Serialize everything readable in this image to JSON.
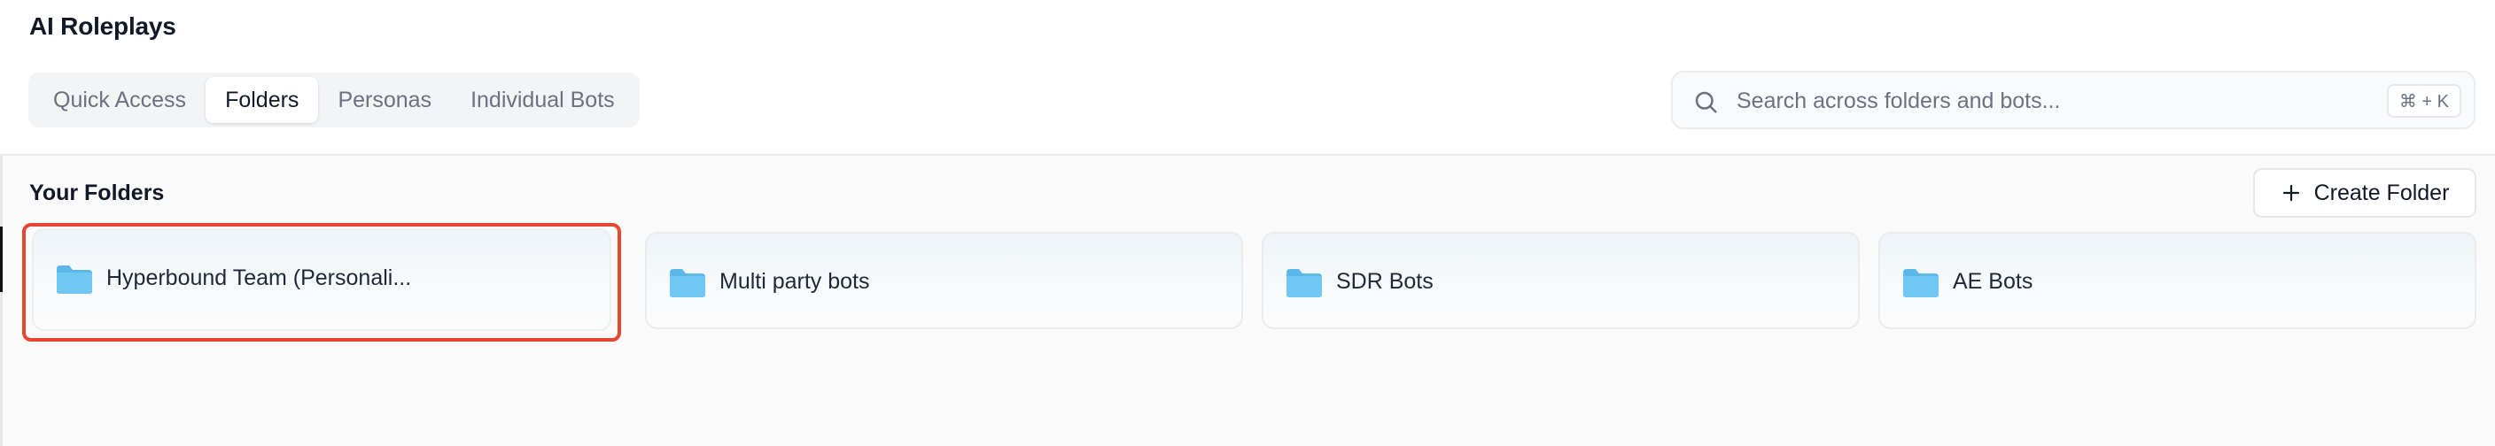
{
  "page": {
    "title": "AI Roleplays"
  },
  "tabs": [
    {
      "label": "Quick Access",
      "active": false
    },
    {
      "label": "Folders",
      "active": true
    },
    {
      "label": "Personas",
      "active": false
    },
    {
      "label": "Individual Bots",
      "active": false
    }
  ],
  "search": {
    "placeholder": "Search across folders and bots...",
    "value": "",
    "shortcut": "⌘ + K",
    "icon": "search-icon"
  },
  "folders_section": {
    "title": "Your Folders",
    "create_label": "Create Folder"
  },
  "folders": [
    {
      "name": "Hyperbound Team (Personali...",
      "icon": "folder-icon",
      "selected": true
    },
    {
      "name": "Multi party bots",
      "icon": "folder-icon",
      "selected": false
    },
    {
      "name": "SDR Bots",
      "icon": "folder-icon",
      "selected": false
    },
    {
      "name": "AE Bots",
      "icon": "folder-icon",
      "selected": false
    }
  ],
  "colors": {
    "folder_icon": "#6fc8f2",
    "highlight": "#e8472f",
    "tab_bg": "#f3f4f6"
  }
}
